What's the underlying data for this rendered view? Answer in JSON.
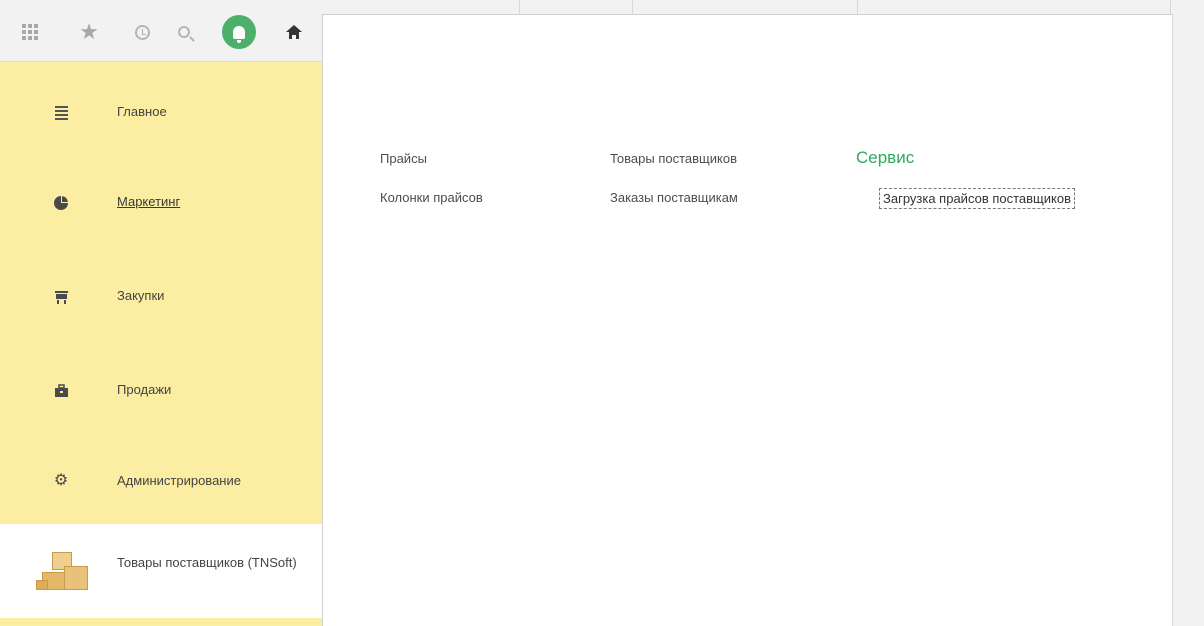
{
  "toolbar": {
    "icons": [
      "apps-grid-icon",
      "favorites-star-icon",
      "history-icon",
      "search-icon",
      "notifications-bell-icon",
      "home-icon"
    ],
    "accent_color": "#4caf6a"
  },
  "sidebar": {
    "background": "#fbeda1",
    "items": [
      {
        "label": "Главное",
        "icon": "menu-lines-icon"
      },
      {
        "label": "Маркетинг",
        "icon": "pie-chart-icon"
      },
      {
        "label": "Закупки",
        "icon": "cart-icon"
      },
      {
        "label": "Продажи",
        "icon": "briefcase-icon"
      },
      {
        "label": "Администрирование",
        "icon": "gear-icon"
      },
      {
        "label": "Товары поставщиков (TNSoft)",
        "icon": "boxes-icon"
      }
    ],
    "selected": "Маркетинг"
  },
  "workspace": {
    "column1": [
      "Прайсы",
      "Колонки прайсов"
    ],
    "column2": [
      "Товары поставщиков",
      "Заказы поставщикам"
    ],
    "column3": {
      "title": "Сервис",
      "items": [
        "Загрузка прайсов поставщиков"
      ]
    }
  }
}
